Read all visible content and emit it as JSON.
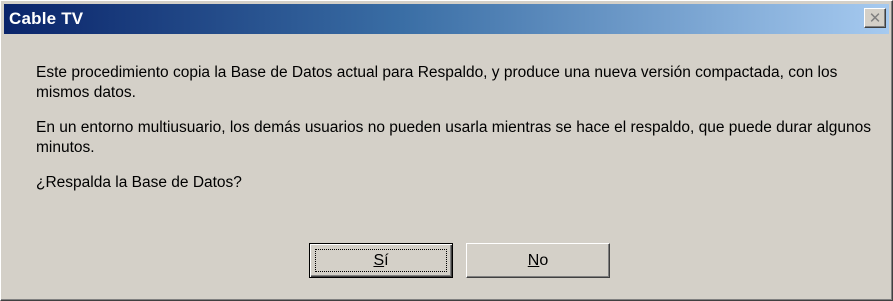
{
  "window": {
    "title": "Cable TV",
    "close_glyph": "✕",
    "close_icon": "close-icon"
  },
  "message": {
    "paragraph1": "Este procedimiento copia la Base de Datos actual para Respaldo, y produce una nueva versión compactada, con los mismos datos.",
    "paragraph2": "En un entorno multiusuario, los demás usuarios no pueden usarla mientras se hace el respaldo, que puede durar algunos minutos.",
    "question": "¿Respalda la Base de Datos?"
  },
  "buttons": {
    "yes": {
      "accel": "S",
      "rest": "í"
    },
    "no": {
      "accel": "N",
      "rest": "o"
    }
  },
  "colors": {
    "titlebar_start": "#0a246a",
    "titlebar_end": "#a6caf0",
    "face": "#d4d0c8"
  }
}
